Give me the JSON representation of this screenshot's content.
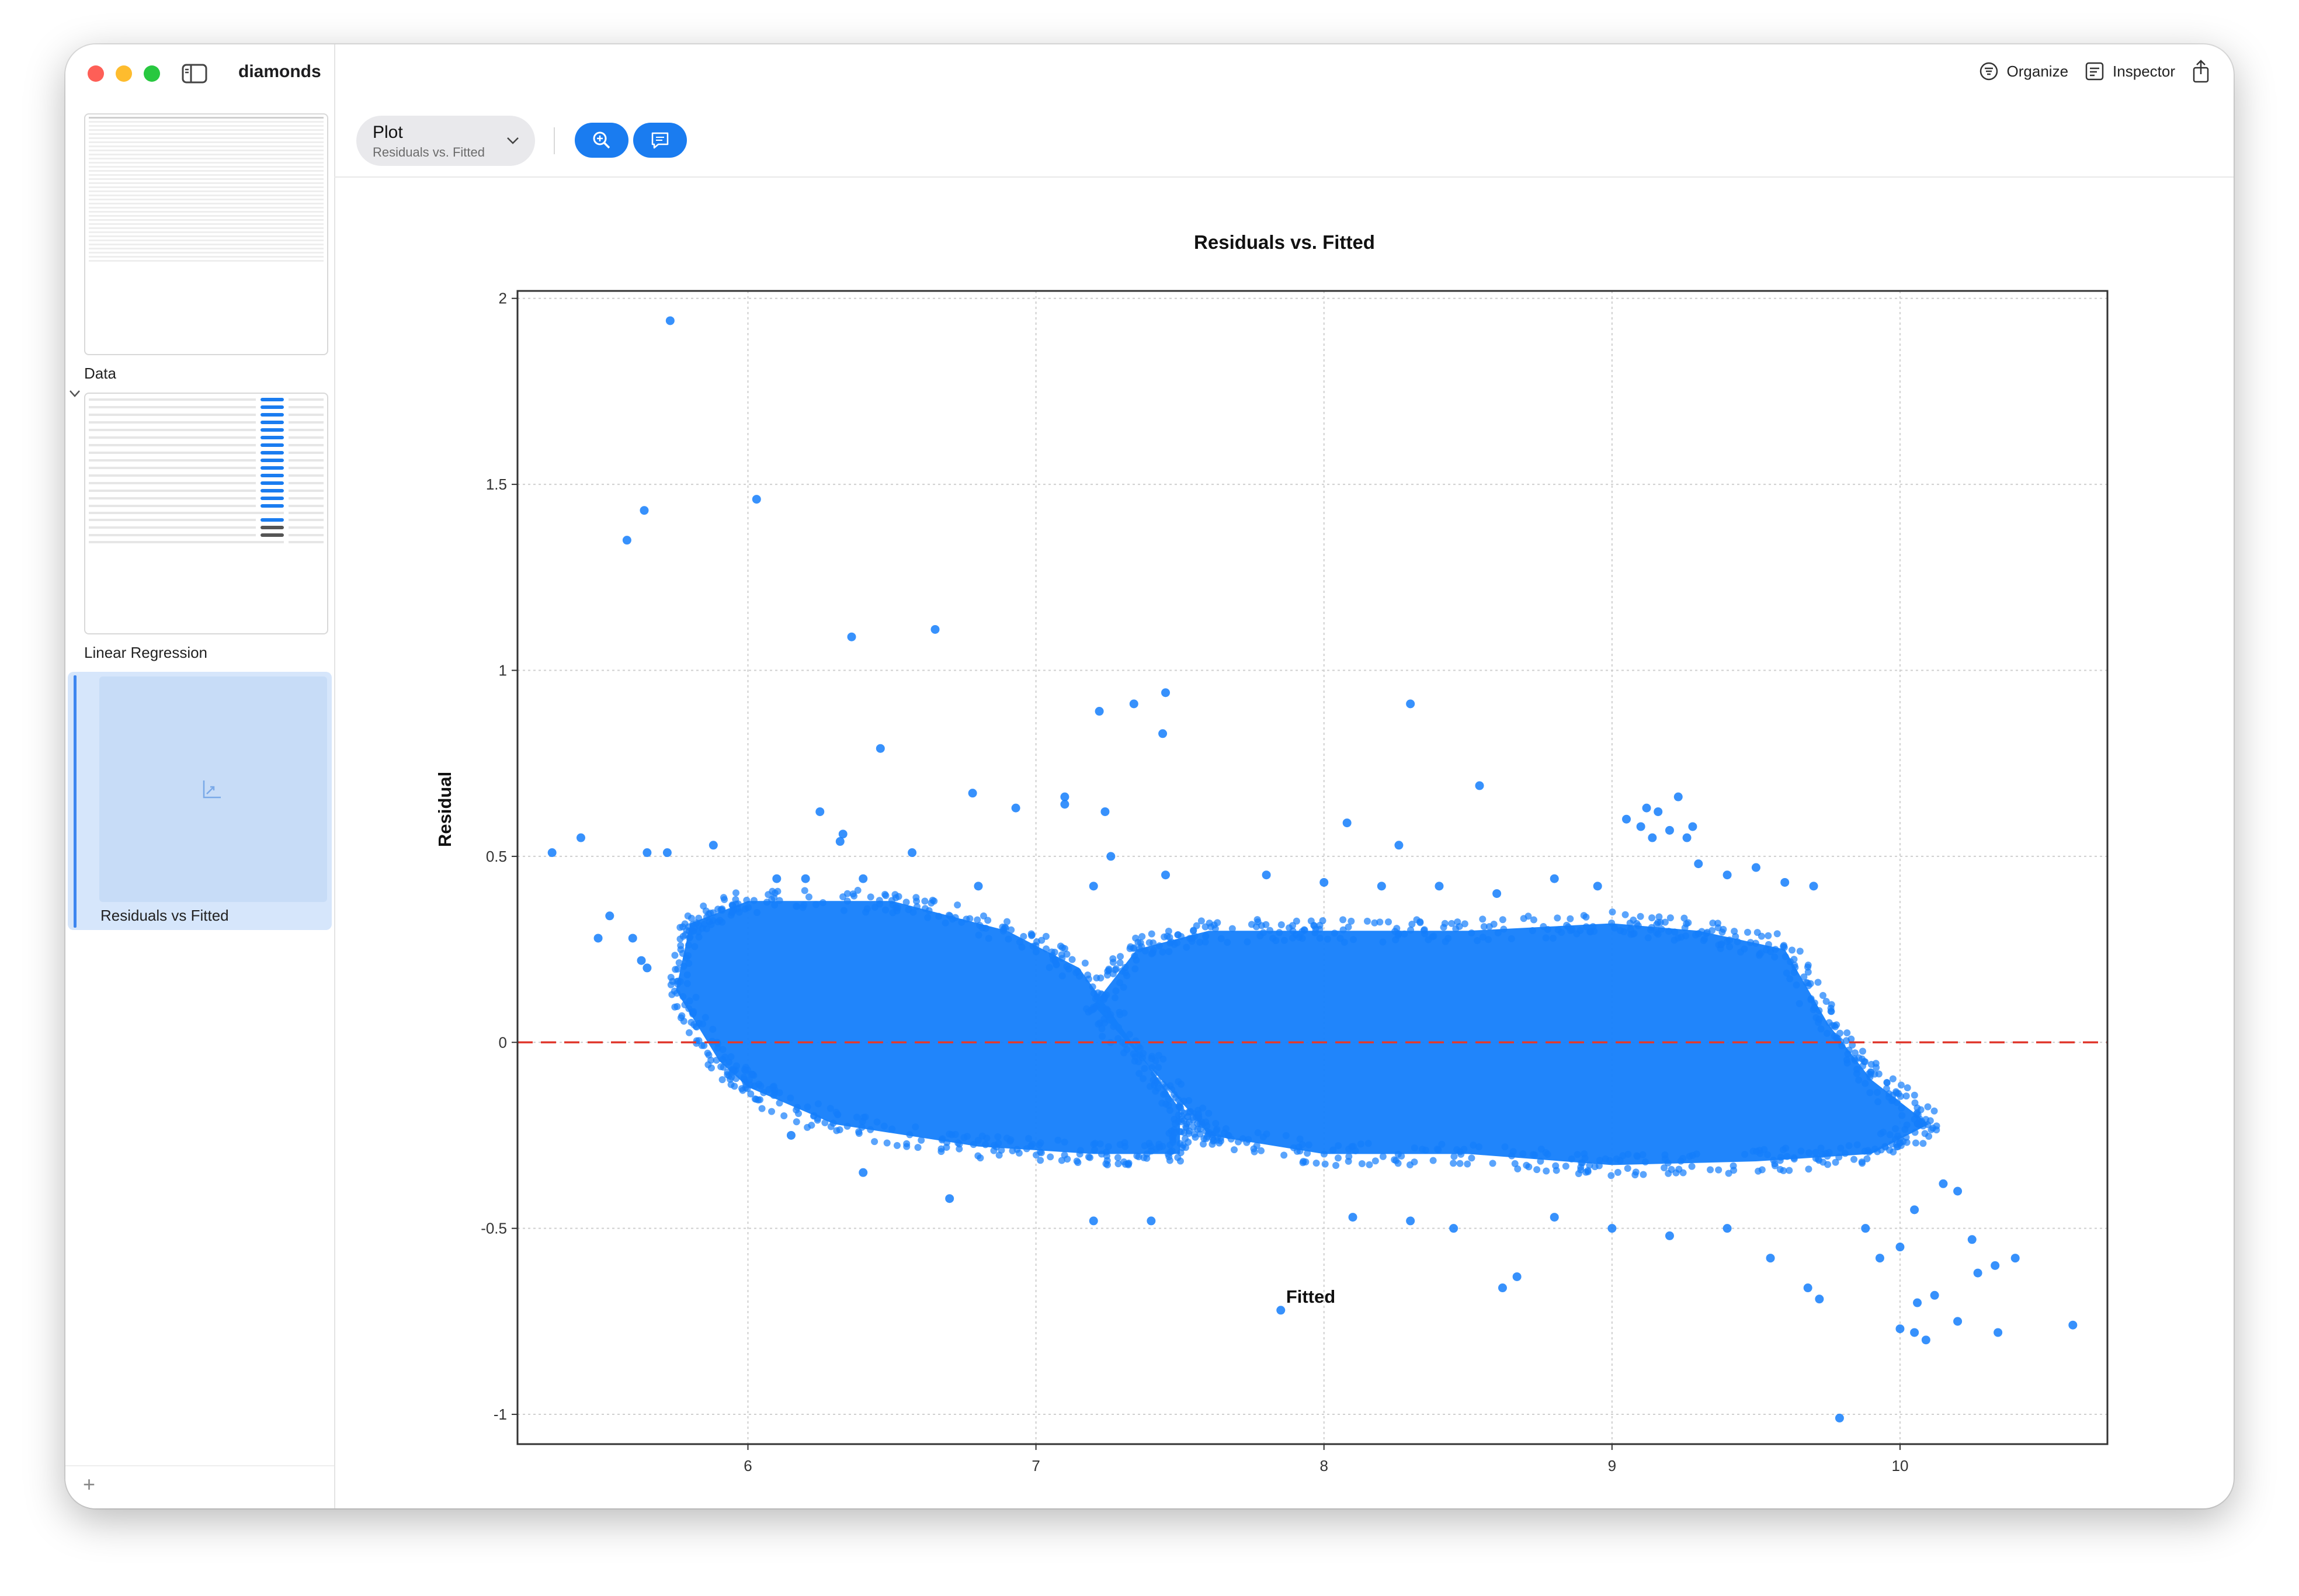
{
  "window": {
    "title": "diamonds"
  },
  "toolbar": {
    "organize_label": "Organize",
    "inspector_label": "Inspector",
    "plot_select": {
      "label": "Plot",
      "value": "Residuals vs. Fitted"
    }
  },
  "sidebar": {
    "items": [
      {
        "label": "Data"
      },
      {
        "label": "Linear Regression"
      },
      {
        "label": "Residuals vs Fitted"
      }
    ]
  },
  "colors": {
    "accent": "#1a7cf0",
    "points": "#147efb",
    "reference_line": "#e03a2f"
  },
  "chart_data": {
    "type": "scatter",
    "title": "Residuals vs. Fitted",
    "xlabel": "Fitted",
    "ylabel": "Residual",
    "xlim": [
      5.2,
      10.72
    ],
    "ylim": [
      -1.08,
      2.02
    ],
    "xticks": [
      6,
      7,
      8,
      9,
      10
    ],
    "yticks": [
      -1,
      -0.5,
      0,
      0.5,
      1,
      1.5,
      2
    ],
    "xtick_labels": [
      "6",
      "7",
      "8",
      "9",
      "10"
    ],
    "ytick_labels": [
      "-1",
      "-0.5",
      "0",
      "0.5",
      "1",
      "1.5",
      "2"
    ],
    "grid": true,
    "reference_line": {
      "y": 0,
      "style": "dashed"
    },
    "dense_regions": [
      {
        "name": "cluster-low",
        "polygon": [
          [
            5.75,
            0.14
          ],
          [
            5.8,
            0.32
          ],
          [
            6.0,
            0.38
          ],
          [
            6.5,
            0.38
          ],
          [
            6.9,
            0.3
          ],
          [
            7.15,
            0.2
          ],
          [
            7.5,
            -0.18
          ],
          [
            7.5,
            -0.3
          ],
          [
            7.2,
            -0.3
          ],
          [
            6.8,
            -0.28
          ],
          [
            6.3,
            -0.22
          ],
          [
            6.0,
            -0.12
          ],
          [
            5.9,
            -0.05
          ]
        ]
      },
      {
        "name": "cluster-high",
        "polygon": [
          [
            7.2,
            0.1
          ],
          [
            7.35,
            0.25
          ],
          [
            7.6,
            0.3
          ],
          [
            8.0,
            0.3
          ],
          [
            8.5,
            0.3
          ],
          [
            9.0,
            0.32
          ],
          [
            9.3,
            0.3
          ],
          [
            9.6,
            0.25
          ],
          [
            9.75,
            0.05
          ],
          [
            9.9,
            -0.1
          ],
          [
            10.1,
            -0.22
          ],
          [
            9.9,
            -0.3
          ],
          [
            9.5,
            -0.32
          ],
          [
            9.0,
            -0.33
          ],
          [
            8.5,
            -0.3
          ],
          [
            8.0,
            -0.3
          ],
          [
            7.6,
            -0.25
          ],
          [
            7.55,
            -0.2
          ]
        ]
      }
    ],
    "points": [
      [
        5.73,
        1.94
      ],
      [
        5.64,
        1.43
      ],
      [
        5.58,
        1.35
      ],
      [
        6.03,
        1.46
      ],
      [
        6.36,
        1.09
      ],
      [
        6.65,
        1.11
      ],
      [
        7.45,
        0.94
      ],
      [
        7.34,
        0.91
      ],
      [
        7.22,
        0.89
      ],
      [
        7.44,
        0.83
      ],
      [
        8.3,
        0.91
      ],
      [
        6.46,
        0.79
      ],
      [
        6.78,
        0.67
      ],
      [
        6.93,
        0.63
      ],
      [
        7.1,
        0.66
      ],
      [
        7.1,
        0.64
      ],
      [
        7.24,
        0.62
      ],
      [
        8.54,
        0.69
      ],
      [
        5.32,
        0.51
      ],
      [
        5.42,
        0.55
      ],
      [
        5.65,
        0.51
      ],
      [
        5.72,
        0.51
      ],
      [
        5.88,
        0.53
      ],
      [
        6.25,
        0.62
      ],
      [
        6.33,
        0.56
      ],
      [
        6.32,
        0.54
      ],
      [
        6.57,
        0.51
      ],
      [
        7.26,
        0.5
      ],
      [
        8.08,
        0.59
      ],
      [
        8.26,
        0.53
      ],
      [
        9.05,
        0.6
      ],
      [
        9.12,
        0.63
      ],
      [
        9.16,
        0.62
      ],
      [
        9.23,
        0.66
      ],
      [
        9.2,
        0.57
      ],
      [
        9.26,
        0.55
      ],
      [
        9.28,
        0.58
      ],
      [
        9.14,
        0.55
      ],
      [
        9.1,
        0.58
      ],
      [
        5.48,
        0.28
      ],
      [
        5.6,
        0.28
      ],
      [
        5.65,
        0.2
      ],
      [
        5.63,
        0.22
      ],
      [
        5.52,
        0.34
      ],
      [
        7.85,
        -0.72
      ],
      [
        8.62,
        -0.66
      ],
      [
        8.67,
        -0.63
      ],
      [
        9.79,
        -1.01
      ],
      [
        10.6,
        -0.76
      ],
      [
        10.34,
        -0.78
      ],
      [
        10.0,
        -0.77
      ],
      [
        10.05,
        -0.78
      ],
      [
        10.09,
        -0.8
      ],
      [
        10.2,
        -0.75
      ],
      [
        10.4,
        -0.58
      ],
      [
        10.33,
        -0.6
      ],
      [
        10.27,
        -0.62
      ],
      [
        10.12,
        -0.68
      ],
      [
        10.06,
        -0.7
      ],
      [
        9.68,
        -0.66
      ],
      [
        9.72,
        -0.69
      ],
      [
        9.55,
        -0.58
      ],
      [
        9.88,
        -0.5
      ],
      [
        9.93,
        -0.58
      ],
      [
        10.25,
        -0.53
      ],
      [
        10.0,
        -0.55
      ],
      [
        10.05,
        -0.45
      ],
      [
        10.15,
        -0.38
      ],
      [
        10.2,
        -0.4
      ],
      [
        8.45,
        -0.5
      ],
      [
        8.3,
        -0.48
      ],
      [
        8.1,
        -0.47
      ],
      [
        7.4,
        -0.48
      ],
      [
        7.2,
        -0.48
      ],
      [
        6.7,
        -0.42
      ],
      [
        6.4,
        -0.35
      ],
      [
        6.15,
        -0.25
      ],
      [
        9.4,
        -0.5
      ],
      [
        9.2,
        -0.52
      ],
      [
        9.0,
        -0.5
      ],
      [
        8.8,
        -0.47
      ],
      [
        6.1,
        0.44
      ],
      [
        6.2,
        0.44
      ],
      [
        6.4,
        0.44
      ],
      [
        6.8,
        0.42
      ],
      [
        7.2,
        0.42
      ],
      [
        7.45,
        0.45
      ],
      [
        7.8,
        0.45
      ],
      [
        8.0,
        0.43
      ],
      [
        8.2,
        0.42
      ],
      [
        8.4,
        0.42
      ],
      [
        8.6,
        0.4
      ],
      [
        8.8,
        0.44
      ],
      [
        8.95,
        0.42
      ],
      [
        9.3,
        0.48
      ],
      [
        9.4,
        0.45
      ],
      [
        9.5,
        0.47
      ],
      [
        9.6,
        0.43
      ],
      [
        9.7,
        0.42
      ]
    ]
  }
}
